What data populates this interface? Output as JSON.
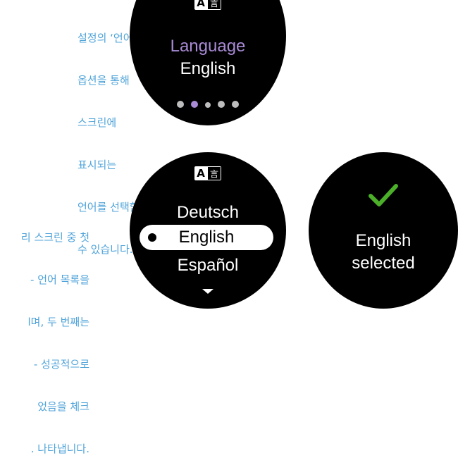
{
  "captions": {
    "top": [
      "설정의 ‘언어’",
      "옵션을 통해",
      "스크린에",
      "표시되는",
      "언어를 선택할",
      "수 있습니다."
    ],
    "bottom": [
      "리 스크린 중 첫",
      "- 언어 목록을",
      "l며, 두 번째는",
      "- 성공적으로",
      "었음을 체크",
      ". 나타냅니다."
    ]
  },
  "icon": {
    "latin": "A",
    "hanzi": "言"
  },
  "watch_top": {
    "label": "Language",
    "value": "English",
    "page_dots": 5,
    "active_page": 2
  },
  "watch_list": {
    "items": [
      "Deutsch",
      "English",
      "Español"
    ],
    "selected_index": 1
  },
  "watch_done": {
    "line1": "English",
    "line2": "selected"
  },
  "colors": {
    "caption": "#4fa3d9",
    "accent": "#a98bd6",
    "check": "#4caf2a"
  }
}
